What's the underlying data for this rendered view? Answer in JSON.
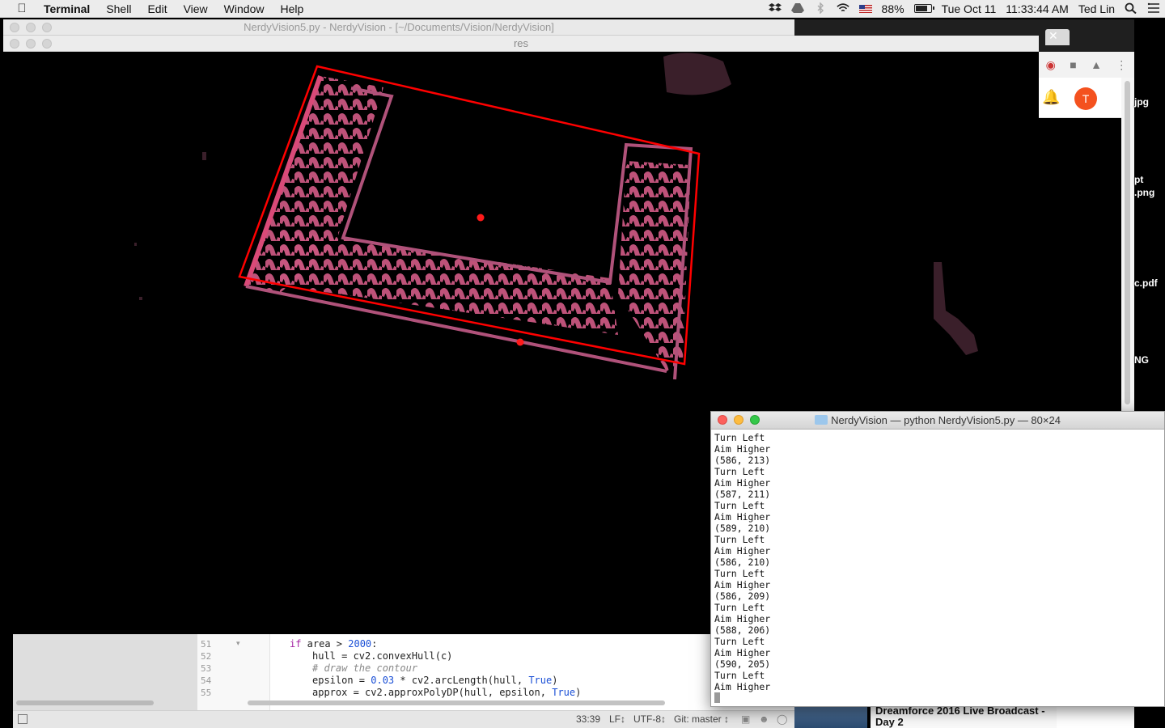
{
  "menubar": {
    "apple": "",
    "app": "Terminal",
    "menus": [
      "Shell",
      "Edit",
      "View",
      "Window",
      "Help"
    ],
    "battery_percent": "88%",
    "battery_level": 0.88,
    "date": "Tue Oct 11",
    "time": "11:33:44 AM",
    "user": "Ted Lin"
  },
  "atom": {
    "title": "NerdyVision5.py - NerdyVision - [~/Documents/Vision/NerdyVision]",
    "line_numbers": [
      "51",
      "52",
      "53",
      "54",
      "55"
    ],
    "code": {
      "l51_kw": "if",
      "l51_a": " area > ",
      "l51_num": "2000",
      "l51_b": ":",
      "l52": "hull = cv2.convexHull(c)",
      "l53": "# draw the contour",
      "l54_a": "epsilon = ",
      "l54_num": "0.03",
      "l54_b": " * cv2.arcLength(hull, ",
      "l54_kw": "True",
      "l54_c": ")",
      "l55_a": "approx = cv2.approxPolyDP(hull, epsilon, ",
      "l55_kw": "True",
      "l55_c": ")"
    },
    "status": {
      "cursor": "33:39",
      "line_ending": "LF↕",
      "encoding": "UTF-8↕",
      "git": "Git: master ↕"
    }
  },
  "res_window": {
    "title": "res"
  },
  "chrome": {
    "avatar_letter": "T",
    "close": "✕"
  },
  "desktop_labels": [
    "jpg",
    "pt",
    ".png",
    "c.pdf",
    "NG"
  ],
  "video": {
    "title": "Dreamforce 2016 Live Broadcast - Day 2"
  },
  "terminal": {
    "title": "NerdyVision — python NerdyVision5.py — 80×24",
    "lines": [
      "Turn Left",
      "Aim Higher",
      "(586, 213)",
      "Turn Left",
      "Aim Higher",
      "(587, 211)",
      "Turn Left",
      "Aim Higher",
      "(589, 210)",
      "Turn Left",
      "Aim Higher",
      "(586, 210)",
      "Turn Left",
      "Aim Higher",
      "(586, 209)",
      "Turn Left",
      "Aim Higher",
      "(588, 206)",
      "Turn Left",
      "Aim Higher",
      "(590, 205)",
      "Turn Left",
      "Aim Higher"
    ]
  },
  "colors": {
    "contour": "#ff0000",
    "tape": "#c8567f",
    "menubar": "#ececec"
  }
}
